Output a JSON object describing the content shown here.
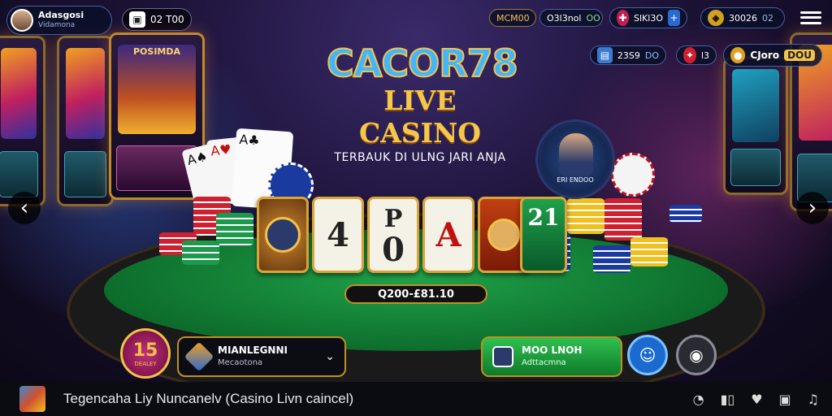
{
  "profile": {
    "name": "Adasgosi",
    "subtitle": "Vidamona"
  },
  "balance_chip": {
    "label": "02 T00"
  },
  "top_stats": [
    {
      "label": "MCM00",
      "icon": "trophy-icon"
    },
    {
      "label": "O3l3nol",
      "value": "OO",
      "icon": "coin-icon"
    },
    {
      "label": "SlKl3O",
      "icon": "flag-icon"
    },
    {
      "label": "30026",
      "value": "02",
      "icon": "gem-icon"
    }
  ],
  "second_row": [
    {
      "label": "23S9",
      "value": "DO",
      "icon": "id-icon"
    },
    {
      "label": "l3",
      "icon": "badge-icon"
    },
    {
      "label": "CJoro",
      "value": "DOU",
      "icon": "wallet-icon"
    }
  ],
  "logo": {
    "title": "CACOR78",
    "subtitle": "LIVE CASINO",
    "tagline": "TERBAUK DI ULNG JARI ANJA"
  },
  "machine_sign": {
    "text": "POSIMDA"
  },
  "table_cards": [
    {
      "face": "",
      "icon": "coin-card-icon"
    },
    {
      "face": "4",
      "top": ""
    },
    {
      "face": "0",
      "top": "P"
    },
    {
      "face": "A",
      "top": ""
    },
    {
      "face": "",
      "icon": "dealer-card-icon"
    },
    {
      "face": "21",
      "top": ""
    }
  ],
  "bet_display": {
    "value": "Q200-£81.10"
  },
  "dealer": {
    "label": "ERI ENDOO"
  },
  "rank_badge": {
    "number": "15",
    "label": "DEALEY"
  },
  "game_select": {
    "title": "MIANLEGNNI",
    "subtitle": "Mecaotona"
  },
  "action_button": {
    "title": "MOO LNOH",
    "subtitle": "Adttacmna"
  },
  "bottom_bar": {
    "text": "Tegencaha Liy Nuncanelv (Casino Livn caincel)",
    "icons": [
      "clock-icon",
      "signal-icon",
      "heart-icon",
      "screen-icon",
      "music-icon"
    ]
  },
  "colors": {
    "accent_gold": "#f2c24a",
    "felt_green": "#0c8a3a",
    "logo_blue": "#3fb6ff"
  }
}
